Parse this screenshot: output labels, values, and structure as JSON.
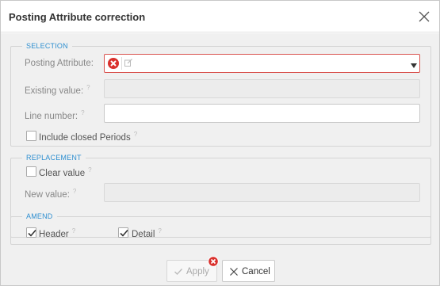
{
  "dialog": {
    "title": "Posting Attribute correction"
  },
  "selection": {
    "legend": "SELECTION",
    "posting_attribute_label": "Posting Attribute:",
    "posting_attribute_value": "",
    "existing_value_label": "Existing value:",
    "existing_value": "",
    "line_number_label": "Line number:",
    "line_number_value": "",
    "include_closed_label": "Include closed Periods",
    "include_closed_checked": false
  },
  "replacement": {
    "legend": "REPLACEMENT",
    "clear_value_label": "Clear value",
    "clear_value_checked": false,
    "new_value_label": "New value:",
    "new_value": ""
  },
  "amend": {
    "legend": "AMEND",
    "header_label": "Header",
    "header_checked": true,
    "detail_label": "Detail",
    "detail_checked": true
  },
  "footer": {
    "apply_label": "Apply",
    "cancel_label": "Cancel"
  },
  "help_glyph": "?",
  "colors": {
    "accent": "#2f8fd0",
    "error": "#d9534f"
  }
}
